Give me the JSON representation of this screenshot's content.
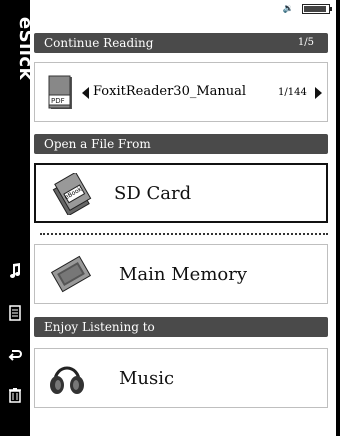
{
  "brand": "eSlick",
  "sidebar_icons": [
    "music-note-icon",
    "document-icon",
    "back-arrow-icon",
    "trash-icon"
  ],
  "status": {
    "volume_icon": "volume-icon",
    "battery_level": 0.9
  },
  "continue_reading": {
    "header": "Continue Reading",
    "count": "1/5",
    "book": {
      "title": "FoxitReader30_Manual",
      "page": "1/144",
      "icon_label": "PDF"
    }
  },
  "open_file": {
    "header": "Open a File From",
    "sd_card": "SD Card",
    "sd_icon_label": "eBook",
    "main_memory": "Main Memory"
  },
  "listening": {
    "header": "Enjoy Listening to",
    "music": "Music"
  }
}
